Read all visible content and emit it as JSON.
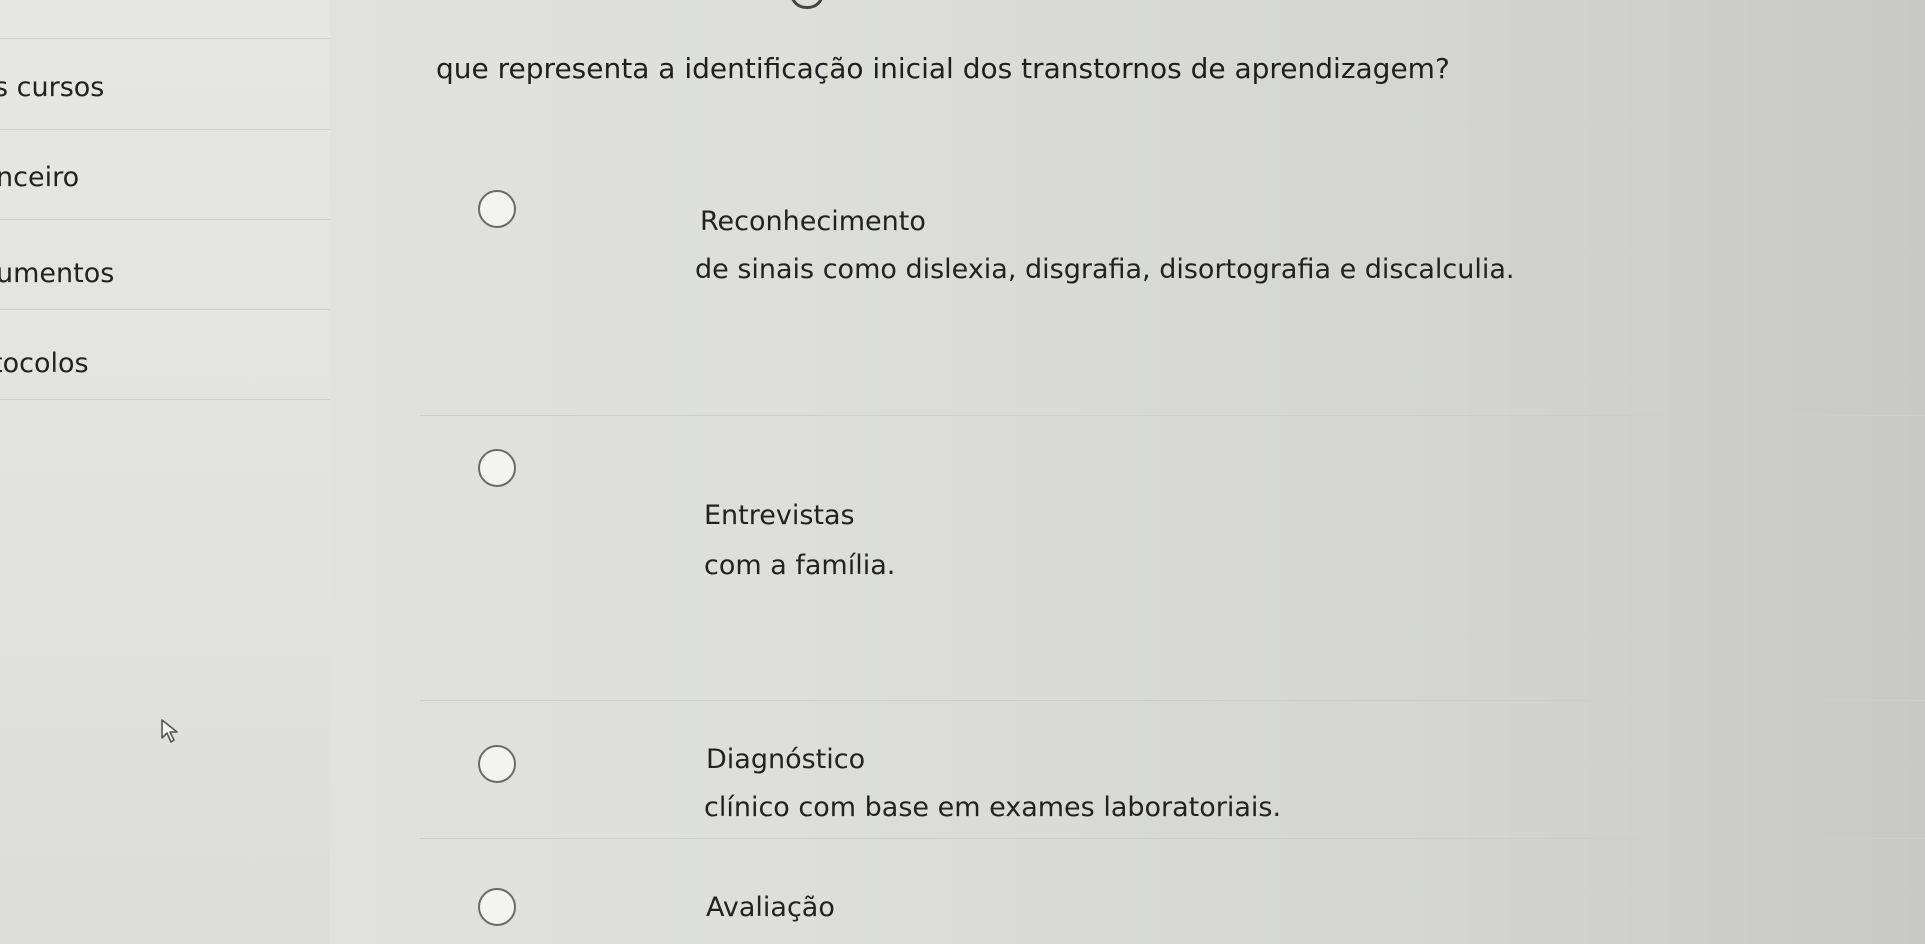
{
  "sidebar": {
    "items": [
      {
        "label": "s cursos"
      },
      {
        "label": "nceiro"
      },
      {
        "label": "umentos"
      },
      {
        "label": "tocolos"
      }
    ]
  },
  "question": {
    "text": "que representa a identificação inicial dos transtornos de aprendizagem?"
  },
  "options": [
    {
      "title": "Reconhecimento",
      "description": "de sinais como dislexia, disgrafia, disortografia e discalculia.",
      "selected": false
    },
    {
      "title": "Entrevistas",
      "description": "com a família.",
      "selected": false
    },
    {
      "title": "Diagnóstico",
      "description": "clínico com base em exames laboratoriais.",
      "selected": false
    },
    {
      "title": "Avaliação",
      "description": "",
      "selected": false
    }
  ],
  "icons": {
    "cursor": "mouse-pointer-icon",
    "radio": "radio-circle-icon"
  }
}
